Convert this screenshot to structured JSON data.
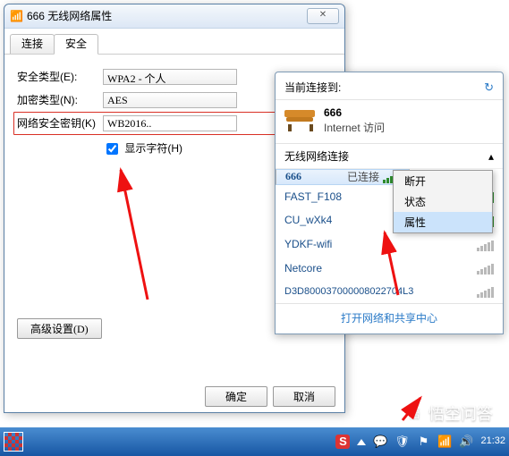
{
  "dialog": {
    "title": "666 无线网络属性",
    "tabs": {
      "connect": "连接",
      "security": "安全"
    },
    "security_type": {
      "label": "安全类型(E):",
      "value": "WPA2 - 个人"
    },
    "encryption": {
      "label": "加密类型(N):",
      "value": "AES"
    },
    "key": {
      "label": "网络安全密钥(K)",
      "value": "WB2016.."
    },
    "show_chars": "显示字符(H)",
    "advanced": "高级设置(D)",
    "ok": "确定",
    "cancel": "取消"
  },
  "flyout": {
    "header": "当前连接到:",
    "current": {
      "name": "666",
      "status": "Internet 访问"
    },
    "section": "无线网络连接",
    "connected_label": "已连接",
    "items": [
      {
        "name": "666",
        "selected": true,
        "strong": true
      },
      {
        "name": "FAST_F108",
        "strong": true
      },
      {
        "name": "CU_wXk4",
        "strong": true
      },
      {
        "name": "YDKF-wifi",
        "strong": false
      },
      {
        "name": "Netcore",
        "strong": false
      },
      {
        "name": "D3D800037000008022704L3",
        "strong": false
      }
    ],
    "context": {
      "disconnect": "断开",
      "status": "状态",
      "properties": "属性"
    },
    "footer": "打开网络和共享中心"
  },
  "watermark": "悟空问答",
  "taskbar": {
    "time": "21:32"
  }
}
